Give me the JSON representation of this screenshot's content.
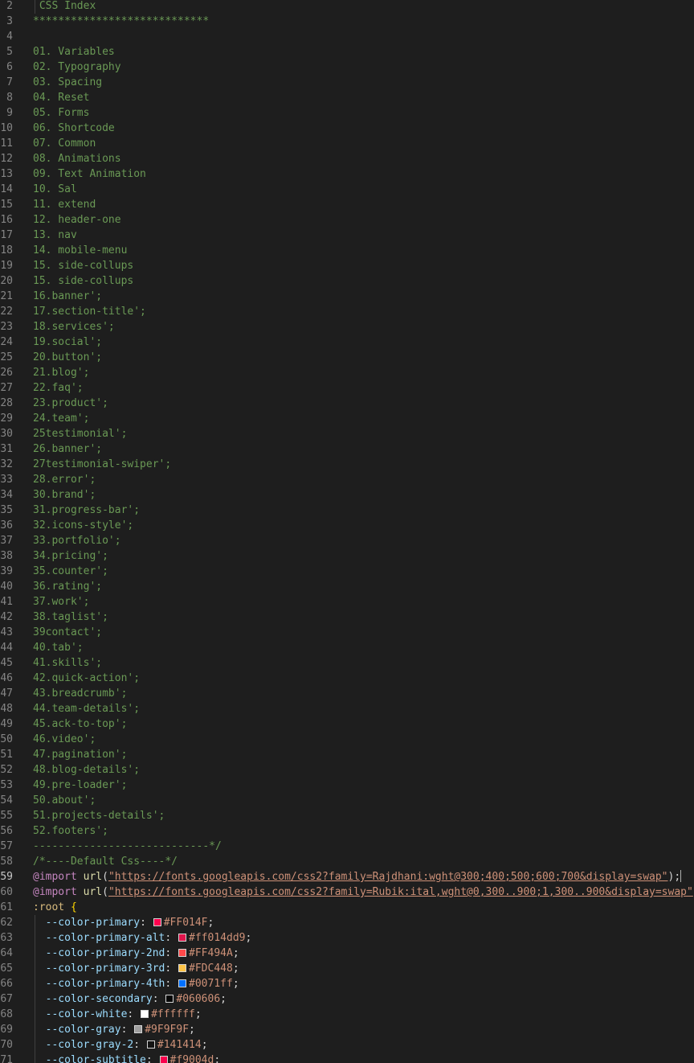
{
  "editor": {
    "css_index_lines": [
      {
        "n": "2",
        "text": " CSS Index"
      },
      {
        "n": "3",
        "text": "****************************"
      },
      {
        "n": "4",
        "text": ""
      },
      {
        "n": "5",
        "text": "01. Variables"
      },
      {
        "n": "6",
        "text": "02. Typography"
      },
      {
        "n": "7",
        "text": "03. Spacing"
      },
      {
        "n": "8",
        "text": "04. Reset"
      },
      {
        "n": "9",
        "text": "05. Forms"
      },
      {
        "n": "10",
        "text": "06. Shortcode"
      },
      {
        "n": "11",
        "text": "07. Common"
      },
      {
        "n": "12",
        "text": "08. Animations"
      },
      {
        "n": "13",
        "text": "09. Text Animation"
      },
      {
        "n": "14",
        "text": "10. Sal"
      },
      {
        "n": "15",
        "text": "11. extend"
      },
      {
        "n": "16",
        "text": "12. header-one"
      },
      {
        "n": "17",
        "text": "13. nav"
      },
      {
        "n": "18",
        "text": "14. mobile-menu"
      },
      {
        "n": "19",
        "text": "15. side-collups"
      },
      {
        "n": "20",
        "text": "15. side-collups"
      },
      {
        "n": "21",
        "text": "16.banner';"
      },
      {
        "n": "22",
        "text": "17.section-title';"
      },
      {
        "n": "23",
        "text": "18.services';"
      },
      {
        "n": "24",
        "text": "19.social';"
      },
      {
        "n": "25",
        "text": "20.button';"
      },
      {
        "n": "26",
        "text": "21.blog';"
      },
      {
        "n": "27",
        "text": "22.faq';"
      },
      {
        "n": "28",
        "text": "23.product';"
      },
      {
        "n": "29",
        "text": "24.team';"
      },
      {
        "n": "30",
        "text": "25testimonial';"
      },
      {
        "n": "31",
        "text": "26.banner';"
      },
      {
        "n": "32",
        "text": "27testimonial-swiper';"
      },
      {
        "n": "33",
        "text": "28.error';"
      },
      {
        "n": "34",
        "text": "30.brand';"
      },
      {
        "n": "35",
        "text": "31.progress-bar';"
      },
      {
        "n": "36",
        "text": "32.icons-style';"
      },
      {
        "n": "37",
        "text": "33.portfolio';"
      },
      {
        "n": "38",
        "text": "34.pricing';"
      },
      {
        "n": "39",
        "text": "35.counter';"
      },
      {
        "n": "40",
        "text": "36.rating';"
      },
      {
        "n": "41",
        "text": "37.work';"
      },
      {
        "n": "42",
        "text": "38.taglist';"
      },
      {
        "n": "43",
        "text": "39contact';"
      },
      {
        "n": "44",
        "text": "40.tab';"
      },
      {
        "n": "45",
        "text": "41.skills';"
      },
      {
        "n": "46",
        "text": "42.quick-action';"
      },
      {
        "n": "47",
        "text": "43.breadcrumb';"
      },
      {
        "n": "48",
        "text": "44.team-details';"
      },
      {
        "n": "49",
        "text": "45.ack-to-top';"
      },
      {
        "n": "50",
        "text": "46.video';"
      },
      {
        "n": "51",
        "text": "47.pagination';"
      },
      {
        "n": "52",
        "text": "48.blog-details';"
      },
      {
        "n": "53",
        "text": "49.pre-loader';"
      },
      {
        "n": "54",
        "text": "50.about';"
      },
      {
        "n": "55",
        "text": "51.projects-details';"
      },
      {
        "n": "56",
        "text": "52.footers';"
      },
      {
        "n": "57",
        "text": "----------------------------*/"
      },
      {
        "n": "58",
        "text": "/*----Default Css----*/"
      }
    ],
    "imports": [
      {
        "n": "59",
        "keyword": "@import",
        "fn": "url",
        "paren_open": "(",
        "url": "\"https://fonts.googleapis.com/css2?family=Rajdhani:wght@300;400;500;600;700&display=swap\"",
        "paren_close": ")",
        "semi": ";",
        "active": true
      },
      {
        "n": "60",
        "keyword": "@import",
        "fn": "url",
        "paren_open": "(",
        "url": "\"https://fonts.googleapis.com/css2?family=Rubik:ital,wght@0,300..900;1,300..900&display=swap\"",
        "paren_close": ")",
        "semi": ";",
        "active": false
      }
    ],
    "root_line": {
      "n": "61",
      "selector": ":root",
      "brace": "{"
    },
    "variables": [
      {
        "n": "62",
        "name": "--color-primary",
        "colon": ":",
        "value": "#FF014F",
        "semi": ";",
        "swatch": "#FF014F"
      },
      {
        "n": "63",
        "name": "--color-primary-alt",
        "colon": ":",
        "value": "#ff014dd9",
        "semi": ";",
        "swatch": "#e0154c"
      },
      {
        "n": "64",
        "name": "--color-primary-2nd",
        "colon": ":",
        "value": "#FF494A",
        "semi": ";",
        "swatch": "#FF494A"
      },
      {
        "n": "65",
        "name": "--color-primary-3rd",
        "colon": ":",
        "value": "#FDC448",
        "semi": ";",
        "swatch": "#FDC448"
      },
      {
        "n": "66",
        "name": "--color-primary-4th",
        "colon": ":",
        "value": "#0071ff",
        "semi": ";",
        "swatch": "#0071ff"
      },
      {
        "n": "67",
        "name": "--color-secondary",
        "colon": ":",
        "value": "#060606",
        "semi": ";",
        "swatch": "#060606"
      },
      {
        "n": "68",
        "name": "--color-white",
        "colon": ":",
        "value": "#ffffff",
        "semi": ";",
        "swatch": "#ffffff"
      },
      {
        "n": "69",
        "name": "--color-gray",
        "colon": ":",
        "value": "#9F9F9F",
        "semi": ";",
        "swatch": "#9F9F9F"
      },
      {
        "n": "70",
        "name": "--color-gray-2",
        "colon": ":",
        "value": "#141414",
        "semi": ";",
        "swatch": "#141414"
      },
      {
        "n": "71",
        "name": "--color-subtitle",
        "colon": ":",
        "value": "#f9004d",
        "semi": ";",
        "swatch": "#f9004d"
      }
    ]
  }
}
